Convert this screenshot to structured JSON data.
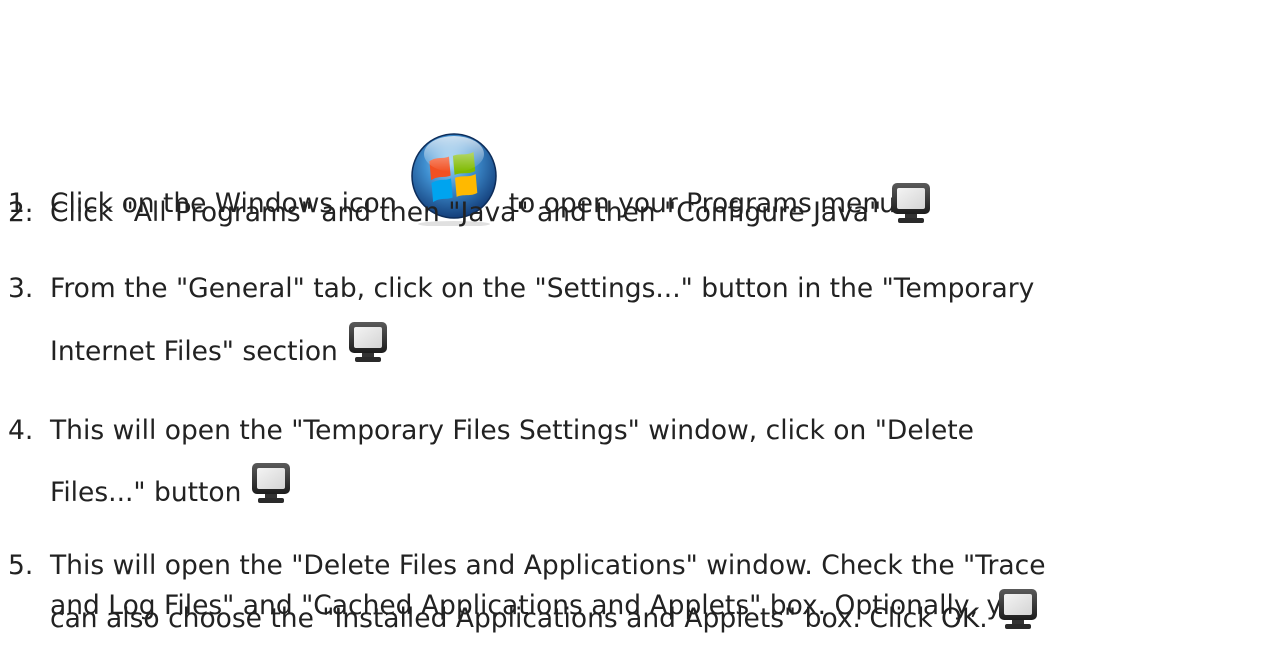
{
  "steps": [
    {
      "number": "1.",
      "before_icon": "Click on the Windows icon",
      "icon": "windows-start-orb-icon",
      "after_icon": "to open your Programs menu"
    },
    {
      "number": "2.",
      "text": "Click \"All Programs\" and then \"Java\" and then \"Configure Java\"",
      "icon": "screenshot-monitor-icon"
    },
    {
      "number": "3.",
      "text_line1": "From the \"General\" tab, click on the \"Settings...\" button in the \"Temporary",
      "text_line2": "Internet Files\" section",
      "icon": "screenshot-monitor-icon"
    },
    {
      "number": "4.",
      "text_line1": "This will open the \"Temporary Files Settings\" window, click on \"Delete",
      "text_line2": "Files...\" button",
      "icon": "screenshot-monitor-icon"
    },
    {
      "number": "5.",
      "text_line1": "This will open the \"Delete Files and Applications\" window. Check the \"Trace",
      "text_line2": "and Log Files\" and \"Cached Applications and Applets\" box. Optionally, you",
      "text_line3": "can also choose the \"Installed Applications and Applets\" box. Click OK.",
      "icon": "screenshot-monitor-icon"
    }
  ]
}
